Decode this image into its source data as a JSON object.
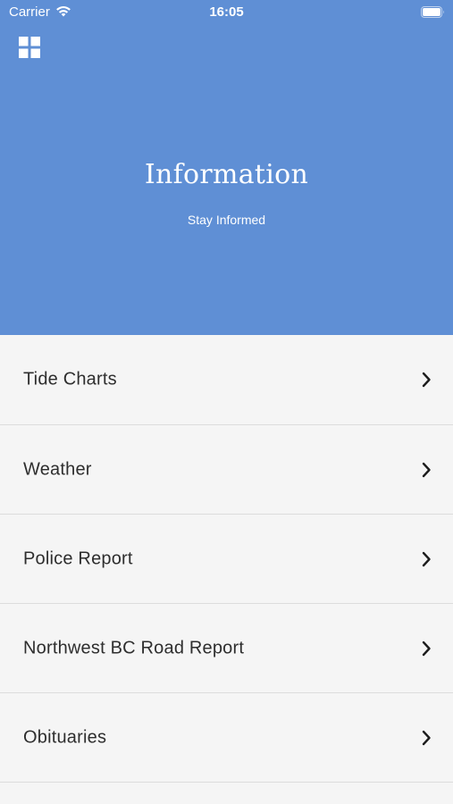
{
  "status_bar": {
    "carrier": "Carrier",
    "time": "16:05",
    "wifi_icon": "wifi-icon",
    "battery_icon": "battery-icon"
  },
  "header": {
    "menu_icon": "grid-menu-icon",
    "title": "Information",
    "subtitle": "Stay Informed",
    "background_color": "#5f8fd5"
  },
  "list": {
    "items": [
      {
        "label": "Tide Charts",
        "icon": "chevron-right-icon"
      },
      {
        "label": "Weather",
        "icon": "chevron-right-icon"
      },
      {
        "label": "Police Report",
        "icon": "chevron-right-icon"
      },
      {
        "label": "Northwest BC Road Report",
        "icon": "chevron-right-icon"
      },
      {
        "label": "Obituaries",
        "icon": "chevron-right-icon"
      }
    ]
  }
}
